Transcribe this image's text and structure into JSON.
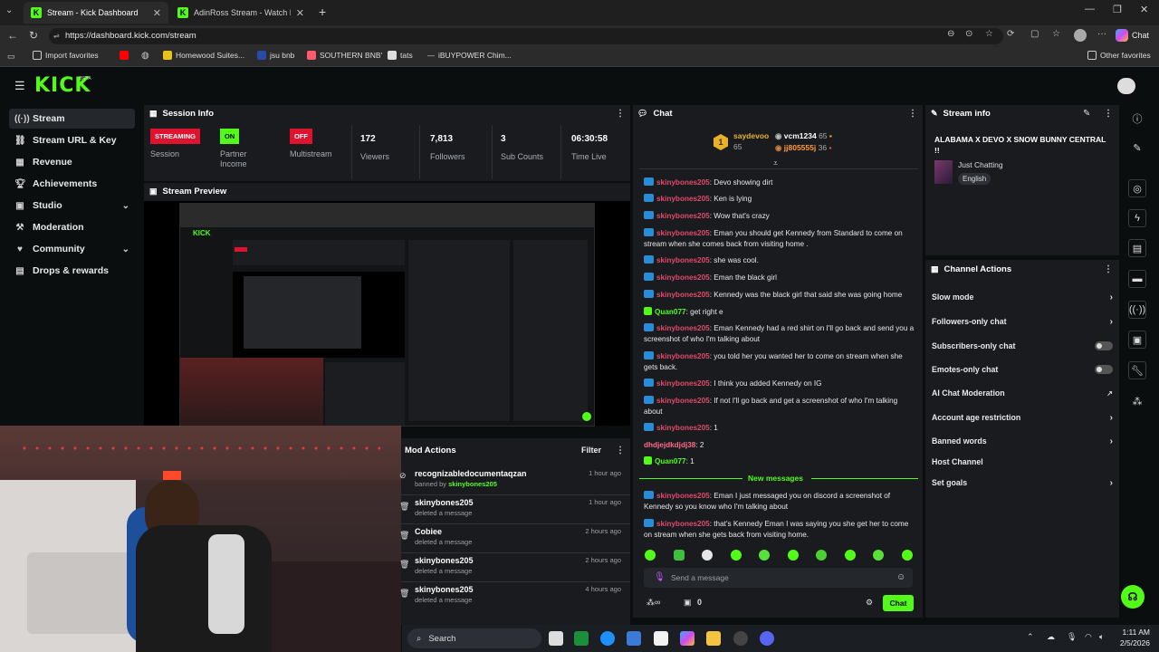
{
  "browser": {
    "tabs": [
      {
        "title": "Stream - Kick Dashboard"
      },
      {
        "title": "AdinRoss Stream - Watch Live on K"
      }
    ],
    "new_tab": "+",
    "url": "https://dashboard.kick.com/stream",
    "bookmarks": [
      "Import favorites",
      "Homewood Suites...",
      "jsu bnb",
      "SOUTHERN BNB'",
      "tats",
      "iBUYPOWER Chim..."
    ],
    "other_favorites": "Other favorites",
    "chat_button": "Chat"
  },
  "kick": {
    "logo": "KICK",
    "logo_beta": "BETA",
    "sidebar": [
      {
        "label": "Stream",
        "icon": "broadcast-icon"
      },
      {
        "label": "Stream URL & Key",
        "icon": "link-icon"
      },
      {
        "label": "Revenue",
        "icon": "revenue-icon"
      },
      {
        "label": "Achievements",
        "icon": "trophy-icon"
      },
      {
        "label": "Studio",
        "icon": "studio-icon"
      },
      {
        "label": "Moderation",
        "icon": "hammer-icon"
      },
      {
        "label": "Community",
        "icon": "community-icon"
      },
      {
        "label": "Drops & rewards",
        "icon": "gift-icon"
      }
    ],
    "session": {
      "title": "Session Info",
      "stats": [
        {
          "value": "STREAMING",
          "label": "Session"
        },
        {
          "value": "ON",
          "label": "Partner Income"
        },
        {
          "value": "OFF",
          "label": "Multistream"
        },
        {
          "value": "172",
          "label": "Viewers"
        },
        {
          "value": "7,813",
          "label": "Followers"
        },
        {
          "value": "3",
          "label": "Sub Counts"
        },
        {
          "value": "06:30:58",
          "label": "Time Live"
        }
      ]
    },
    "preview_title": "Stream Preview",
    "mod_actions": {
      "title": "Mod Actions",
      "filter": "Filter",
      "items": [
        {
          "name": "recognizabledocumentaqzan",
          "sub_prefix": "banned by ",
          "sub_user": "skinybones205",
          "time": "1 hour ago"
        },
        {
          "name": "skinybones205",
          "sub": "deleted a message",
          "time": "1 hour ago"
        },
        {
          "name": "Cobiee",
          "sub": "deleted a message",
          "time": "2 hours ago"
        },
        {
          "name": "skinybones205",
          "sub": "deleted a message",
          "time": "2 hours ago"
        },
        {
          "name": "skinybones205",
          "sub": "deleted a message",
          "time": "4 hours ago"
        }
      ]
    },
    "chat": {
      "title": "Chat",
      "leaders": [
        {
          "rank": "1",
          "name": "saydevoo",
          "count": "65"
        },
        {
          "name": "vcm1234",
          "count": "65"
        },
        {
          "name": "jj805555j",
          "count": "36"
        }
      ],
      "messages": [
        {
          "user": "skinybones205",
          "text": "Devo showing dirt"
        },
        {
          "user": "skinybones205",
          "text": "Ken is lying"
        },
        {
          "user": "skinybones205",
          "text": "Wow that's crazy"
        },
        {
          "user": "skinybones205",
          "text": "Eman you should get Kennedy from Standard to come on stream when she comes back from visiting home ."
        },
        {
          "user": "skinybones205",
          "text": "she was cool."
        },
        {
          "user": "skinybones205",
          "text": "Eman the black girl"
        },
        {
          "user": "skinybones205",
          "text": "Kennedy was the black girl that said she was going home"
        },
        {
          "user": "Quan077",
          "text": "get right e"
        },
        {
          "user": "skinybones205",
          "text": "Eman Kennedy had a red shirt on I'll go back and send you a screenshot of who I'm talking about"
        },
        {
          "user": "skinybones205",
          "text": "you told her you wanted her to come on stream when she gets back."
        },
        {
          "user": "skinybones205",
          "text": "I think you added Kennedy on IG"
        },
        {
          "user": "skinybones205",
          "text": "If not I'll go back and get a screenshot of who I'm talking about"
        },
        {
          "user": "skinybones205",
          "text": "1"
        },
        {
          "user": "dhdjejdkdjdj38",
          "text": "2"
        },
        {
          "user": "Quan077",
          "text": "1"
        }
      ],
      "new_messages_label": "New messages",
      "new_messages": [
        {
          "user": "skinybones205",
          "text": "Eman I just messaged you on discord a screenshot of Kennedy so you know who I'm talking about"
        },
        {
          "user": "skinybones205",
          "text": "that's Kennedy Eman I was saying you she get her to come on stream when she gets back from visiting home."
        }
      ],
      "input_placeholder": "Send a message",
      "points": "0",
      "send_button": "Chat"
    },
    "stream_info": {
      "title": "Stream info",
      "stream_title": "ALABAMA X DEVO X SNOW BUNNY CENTRAL !!",
      "category": "Just Chatting",
      "language": "English"
    },
    "channel_actions": {
      "title": "Channel Actions",
      "items": [
        {
          "label": "Slow mode",
          "control": "chevron"
        },
        {
          "label": "Followers-only chat",
          "control": "chevron"
        },
        {
          "label": "Subscribers-only chat",
          "control": "toggle"
        },
        {
          "label": "Emotes-only chat",
          "control": "toggle"
        },
        {
          "label": "AI Chat Moderation",
          "control": "external"
        },
        {
          "label": "Account age restriction",
          "control": "chevron"
        },
        {
          "label": "Banned words",
          "control": "chevron"
        },
        {
          "label": "Host Channel",
          "control": "none"
        },
        {
          "label": "Set goals",
          "control": "chevron"
        }
      ]
    }
  },
  "taskbar": {
    "search": "Search",
    "time": "1:11 AM",
    "date": "2/5/2026"
  },
  "colors": {
    "accent": "#53fc18",
    "streaming": "#e0132f",
    "panel": "#191b1f",
    "bg": "#0b0e0f"
  }
}
